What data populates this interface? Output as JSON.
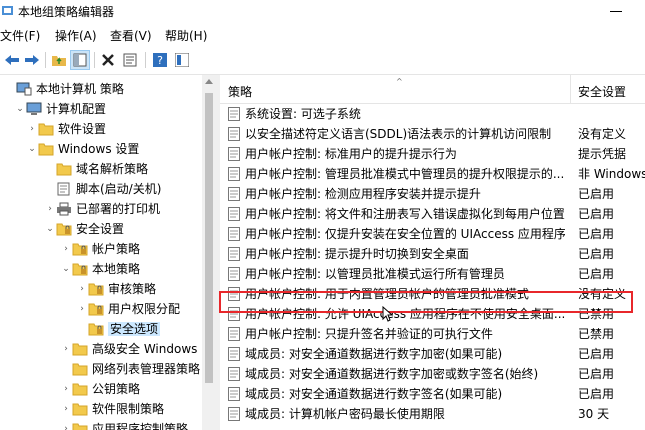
{
  "window": {
    "title": "本地组策略编辑器"
  },
  "menu": [
    "文件(F)",
    "操作(A)",
    "查看(V)",
    "帮助(H)"
  ],
  "toolbar": [
    "back-arrow-icon",
    "forward-arrow-icon",
    "up-folder-icon",
    "show-hide-tree-icon",
    "delete-icon",
    "properties-icon",
    "help-icon",
    "help-pane-icon"
  ],
  "tree": [
    {
      "label": "本地计算机 策略",
      "level": 0,
      "icon": "computer-policy-icon",
      "chevron": ""
    },
    {
      "label": "计算机配置",
      "level": 1,
      "icon": "computer-icon",
      "chevron": "⌄"
    },
    {
      "label": "软件设置",
      "level": 2,
      "icon": "folder-icon",
      "chevron": "›"
    },
    {
      "label": "Windows 设置",
      "level": 2,
      "icon": "folder-icon",
      "chevron": "⌄"
    },
    {
      "label": "域名解析策略",
      "level": 3,
      "icon": "folder-icon",
      "chevron": ""
    },
    {
      "label": "脚本(启动/关机)",
      "level": 3,
      "icon": "script-icon",
      "chevron": ""
    },
    {
      "label": "已部署的打印机",
      "level": 3,
      "icon": "printer-icon",
      "chevron": "›"
    },
    {
      "label": "安全设置",
      "level": 3,
      "icon": "security-folder-icon",
      "chevron": "⌄"
    },
    {
      "label": "帐户策略",
      "level": 4,
      "icon": "security-folder-icon",
      "chevron": "›"
    },
    {
      "label": "本地策略",
      "level": 4,
      "icon": "security-folder-icon",
      "chevron": "⌄"
    },
    {
      "label": "审核策略",
      "level": 5,
      "icon": "security-folder-icon",
      "chevron": "›"
    },
    {
      "label": "用户权限分配",
      "level": 5,
      "icon": "security-folder-icon",
      "chevron": "›"
    },
    {
      "label": "安全选项",
      "level": 5,
      "icon": "security-folder-icon",
      "chevron": "",
      "selected": true
    },
    {
      "label": "高级安全 Windows",
      "level": 4,
      "icon": "folder-icon",
      "chevron": "›"
    },
    {
      "label": "网络列表管理器策略",
      "level": 4,
      "icon": "folder-icon",
      "chevron": ""
    },
    {
      "label": "公钥策略",
      "level": 4,
      "icon": "folder-icon",
      "chevron": "›"
    },
    {
      "label": "软件限制策略",
      "level": 4,
      "icon": "folder-icon",
      "chevron": "›"
    },
    {
      "label": "应用程序控制策略",
      "level": 4,
      "icon": "folder-icon",
      "chevron": "›"
    }
  ],
  "list": {
    "col_policy": "策略",
    "col_setting": "安全设置",
    "rows": [
      {
        "name": "系统设置: 可选子系统",
        "value": ""
      },
      {
        "name": "以安全描述符定义语言(SDDL)语法表示的计算机访问限制",
        "value": "没有定义"
      },
      {
        "name": "用户帐户控制: 标准用户的提升提示行为",
        "value": "提示凭据"
      },
      {
        "name": "用户帐户控制: 管理员批准模式中管理员的提升权限提示的...",
        "value": "非 Windows"
      },
      {
        "name": "用户帐户控制: 检测应用程序安装并提示提升",
        "value": "已启用"
      },
      {
        "name": "用户帐户控制: 将文件和注册表写入错误虚拟化到每用户位置",
        "value": "已启用"
      },
      {
        "name": "用户帐户控制: 仅提升安装在安全位置的 UIAccess 应用程序",
        "value": "已启用"
      },
      {
        "name": "用户帐户控制: 提示提升时切换到安全桌面",
        "value": "已启用"
      },
      {
        "name": "用户帐户控制: 以管理员批准模式运行所有管理员",
        "value": "已启用"
      },
      {
        "name": "用户帐户控制: 用于内置管理员帐户的管理员批准模式",
        "value": "没有定义",
        "highlighted": true
      },
      {
        "name": "用户帐户控制: 允许 UIAccess 应用程序在不使用安全桌面...",
        "value": "已禁用"
      },
      {
        "name": "用户帐户控制: 只提升签名并验证的可执行文件",
        "value": "已禁用"
      },
      {
        "name": "域成员: 对安全通道数据进行数字加密(如果可能)",
        "value": "已启用"
      },
      {
        "name": "域成员: 对安全通道数据进行数字加密或数字签名(始终)",
        "value": "已启用"
      },
      {
        "name": "域成员: 对安全通道数据进行数字签名(如果可能)",
        "value": "已启用"
      },
      {
        "name": "域成员: 计算机帐户密码最长使用期限",
        "value": "30 天"
      }
    ]
  },
  "colors": {
    "highlight_border": "#e8272b",
    "selection": "#cce8ff",
    "folder": "#f2c94c"
  }
}
